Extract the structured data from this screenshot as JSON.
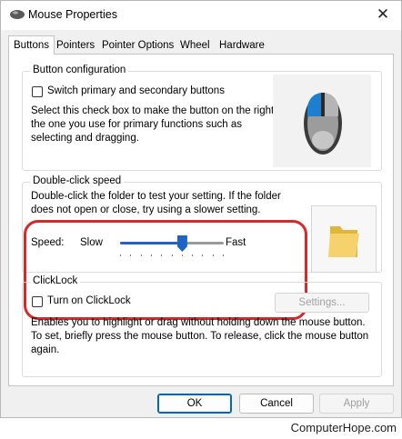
{
  "window": {
    "title": "Mouse Properties",
    "close_glyph": "✕"
  },
  "tabs": [
    {
      "label": "Buttons",
      "active": true
    },
    {
      "label": "Pointers",
      "active": false
    },
    {
      "label": "Pointer Options",
      "active": false
    },
    {
      "label": "Wheel",
      "active": false
    },
    {
      "label": "Hardware",
      "active": false
    }
  ],
  "button_configuration": {
    "legend": "Button configuration",
    "checkbox_label": "Switch primary and secondary buttons",
    "checked": false,
    "description": [
      "Select this check box to make the button on the right",
      "the one you use for primary functions such as",
      "selecting and dragging."
    ],
    "illustration_icon": "mouse-icon"
  },
  "double_click_speed": {
    "legend": "Double-click speed",
    "description": [
      "Double-click the folder to test your setting. If the folder",
      "does not open or close, try using a slower setting."
    ],
    "speed_label": "Speed:",
    "slow_label": "Slow",
    "fast_label": "Fast",
    "slider_value": 0.6,
    "test_icon": "folder-icon"
  },
  "clicklock": {
    "legend": "ClickLock",
    "checkbox_label": "Turn on ClickLock",
    "checked": false,
    "settings_label": "Settings...",
    "description": [
      "Enables you to highlight or drag without holding down the mouse button.",
      "To set, briefly press the mouse button. To release, click the mouse button",
      "again."
    ]
  },
  "footer": {
    "ok_label": "OK",
    "cancel_label": "Cancel",
    "apply_label": "Apply"
  },
  "watermark": "ComputerHope.com",
  "colors": {
    "accent": "#1e63c6",
    "highlight": "#d42a2a"
  }
}
